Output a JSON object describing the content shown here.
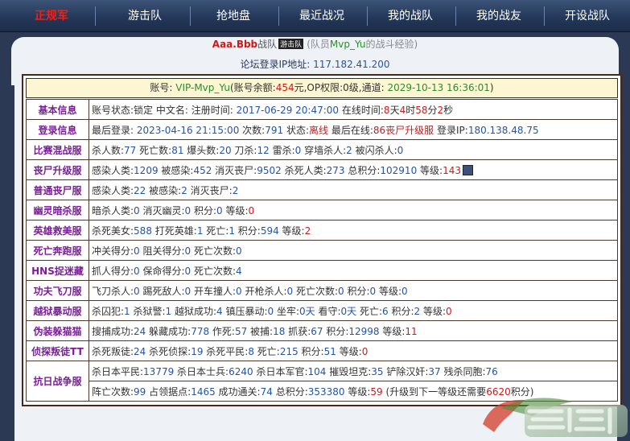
{
  "nav": [
    "正规军",
    "游击队",
    "抢地盘",
    "最近战况",
    "我的战队",
    "我的战友",
    "开设战队"
  ],
  "title": {
    "name": "Aaa.Bbb",
    "suffix": "战队",
    "tag": "游击队",
    "note_pre": "(队员",
    "player": "Mvp_Yu",
    "note_post": "的战斗经验)"
  },
  "ip": {
    "label": "论坛登录IP地址:",
    "value": "117.182.41.200"
  },
  "account": {
    "label": "账号:",
    "id": "VIP-Mvp_Yu",
    "bal_pre": "(账号余额:",
    "balance": "454",
    "bal_post": "元,OP权限:0级,通道:",
    "channel": "2029-10-13 16:36:01",
    "close": ")"
  },
  "basic": {
    "label": "基本信息",
    "t1": "账号状态:锁定 中文名: 注册时间:",
    "reg": "2017-06-29 20:47:00",
    "t2": "在线时间:",
    "d": "8",
    "t3": "天",
    "h": "4",
    "t4": "时",
    "m": "58",
    "t5": "分",
    "s": "2",
    "t6": "秒"
  },
  "login": {
    "label": "登录信息",
    "t1": "最后登录:",
    "last": "2023-04-16 21:15:00",
    "t2": "次数:",
    "count": "791",
    "t3": "状态:",
    "state": "离线",
    "t4": "最后在线:",
    "server": "86丧尸升级服",
    "t5": "登录IP:",
    "ip": "180.138.48.75"
  },
  "modes": [
    {
      "label": "比赛混战服",
      "parts": [
        [
          "杀人数:",
          ""
        ],
        [
          "77",
          "b"
        ],
        [
          " 死亡数:",
          ""
        ],
        [
          "81",
          "b"
        ],
        [
          " 爆头数:",
          ""
        ],
        [
          "20",
          "b"
        ],
        [
          " 刀杀:",
          ""
        ],
        [
          "12",
          "b"
        ],
        [
          " 雷杀:",
          ""
        ],
        [
          "0",
          "b"
        ],
        [
          " 穿墙杀人:",
          ""
        ],
        [
          "2",
          "b"
        ],
        [
          " 被闪杀人:",
          ""
        ],
        [
          "0",
          "b"
        ]
      ]
    },
    {
      "label": "丧尸升级服",
      "parts": [
        [
          "感染人类:",
          ""
        ],
        [
          "1209",
          "b"
        ],
        [
          " 被感染:",
          ""
        ],
        [
          "452",
          "b"
        ],
        [
          " 消灭丧尸:",
          ""
        ],
        [
          "9502",
          "b"
        ],
        [
          " 杀死人类:",
          ""
        ],
        [
          "273",
          "b"
        ],
        [
          " 总积分:",
          ""
        ],
        [
          "102910",
          "b"
        ],
        [
          " 等级:",
          ""
        ],
        [
          "143",
          "r"
        ]
      ],
      "badge": true
    },
    {
      "label": "普通丧尸服",
      "parts": [
        [
          "感染人类:",
          ""
        ],
        [
          "22",
          "b"
        ],
        [
          " 被感染:",
          ""
        ],
        [
          "2",
          "b"
        ],
        [
          " 消灭丧尸:",
          ""
        ],
        [
          "2",
          "b"
        ]
      ]
    },
    {
      "label": "幽灵暗杀服",
      "parts": [
        [
          "暗杀人类:",
          ""
        ],
        [
          "0",
          "b"
        ],
        [
          " 消灭幽灵:",
          ""
        ],
        [
          "0",
          "b"
        ],
        [
          " 积分:",
          ""
        ],
        [
          "0",
          "b"
        ],
        [
          " 等级:",
          ""
        ],
        [
          "0",
          "r"
        ]
      ]
    },
    {
      "label": "英雄救美服",
      "parts": [
        [
          "杀死美女:",
          ""
        ],
        [
          "588",
          "b"
        ],
        [
          " 打死英雄:",
          ""
        ],
        [
          "1",
          "b"
        ],
        [
          " 死亡:",
          ""
        ],
        [
          "1",
          "b"
        ],
        [
          " 积分:",
          ""
        ],
        [
          "594",
          "b"
        ],
        [
          " 等级:",
          ""
        ],
        [
          "2",
          "r"
        ]
      ]
    },
    {
      "label": "死亡奔跑服",
      "parts": [
        [
          "冲关得分:",
          ""
        ],
        [
          "0",
          "b"
        ],
        [
          " 阻关得分:",
          ""
        ],
        [
          "0",
          "b"
        ],
        [
          " 死亡次数:",
          ""
        ],
        [
          "0",
          "b"
        ]
      ]
    },
    {
      "label": "HNS捉迷藏",
      "parts": [
        [
          "抓人得分:",
          ""
        ],
        [
          "0",
          "b"
        ],
        [
          " 保命得分:",
          ""
        ],
        [
          "0",
          "b"
        ],
        [
          " 死亡次数:",
          ""
        ],
        [
          "4",
          "b"
        ]
      ]
    },
    {
      "label": "功夫飞刀服",
      "parts": [
        [
          "飞刀杀人:",
          ""
        ],
        [
          "0",
          "b"
        ],
        [
          " 踢死敌人:",
          ""
        ],
        [
          "0",
          "b"
        ],
        [
          " 开车撞人:",
          ""
        ],
        [
          "0",
          "b"
        ],
        [
          " 开枪杀人:",
          ""
        ],
        [
          "0",
          "b"
        ],
        [
          " 死亡次数:",
          ""
        ],
        [
          "0",
          "b"
        ],
        [
          " 积分:",
          ""
        ],
        [
          "0",
          "b"
        ],
        [
          " 等级:",
          ""
        ],
        [
          "0",
          "b"
        ]
      ]
    },
    {
      "label": "越狱暴动服",
      "parts": [
        [
          "杀囚犯:",
          ""
        ],
        [
          "1",
          "b"
        ],
        [
          " 杀狱警:",
          ""
        ],
        [
          "1",
          "b"
        ],
        [
          " 越狱成功:",
          ""
        ],
        [
          "4",
          "b"
        ],
        [
          " 镇压暴动:",
          ""
        ],
        [
          "0",
          "b"
        ],
        [
          " 坐牢:",
          ""
        ],
        [
          "0天",
          "b"
        ],
        [
          " 看守:",
          ""
        ],
        [
          "0天",
          "b"
        ],
        [
          " 死亡:",
          ""
        ],
        [
          "6",
          "b"
        ],
        [
          " 积分:",
          ""
        ],
        [
          "2",
          "b"
        ],
        [
          " 等级:",
          ""
        ],
        [
          "0",
          "r"
        ]
      ]
    },
    {
      "label": "伪装躲猫猫",
      "parts": [
        [
          "搜捕成功:",
          ""
        ],
        [
          "24",
          "b"
        ],
        [
          " 躲藏成功:",
          ""
        ],
        [
          "778",
          "b"
        ],
        [
          " 作死:",
          ""
        ],
        [
          "57",
          "b"
        ],
        [
          " 被捕:",
          ""
        ],
        [
          "18",
          "b"
        ],
        [
          " 抓获:",
          ""
        ],
        [
          "67",
          "b"
        ],
        [
          " 积分:",
          ""
        ],
        [
          "12998",
          "b"
        ],
        [
          " 等级:",
          ""
        ],
        [
          "11",
          "r"
        ]
      ]
    },
    {
      "label": "侦探叛徒TT",
      "parts": [
        [
          "杀死叛徒:",
          ""
        ],
        [
          "24",
          "b"
        ],
        [
          " 杀死侦探:",
          ""
        ],
        [
          "19",
          "b"
        ],
        [
          " 杀死平民:",
          ""
        ],
        [
          "8",
          "b"
        ],
        [
          " 死亡:",
          ""
        ],
        [
          "215",
          "b"
        ],
        [
          " 积分:",
          ""
        ],
        [
          "51",
          "b"
        ],
        [
          " 等级:",
          ""
        ],
        [
          "0",
          "r"
        ]
      ]
    }
  ],
  "war": {
    "label": "抗日战争服",
    "line1": [
      [
        "杀日本平民:",
        ""
      ],
      [
        "13779",
        "b"
      ],
      [
        " 杀日本士兵:",
        ""
      ],
      [
        "6240",
        "b"
      ],
      [
        " 杀日本军官:",
        ""
      ],
      [
        "104",
        "b"
      ],
      [
        " 摧毁坦克:",
        ""
      ],
      [
        "35",
        "b"
      ],
      [
        " 铲除汉奸:",
        ""
      ],
      [
        "37",
        "b"
      ],
      [
        " 残杀同胞:",
        ""
      ],
      [
        "76",
        "b"
      ]
    ],
    "line2": [
      [
        "阵亡次数:",
        ""
      ],
      [
        "99",
        "b"
      ],
      [
        " 占领据点:",
        ""
      ],
      [
        "1465",
        "b"
      ],
      [
        " 成功通关:",
        ""
      ],
      [
        "74",
        "b"
      ],
      [
        " 总积分:",
        ""
      ],
      [
        "353380",
        "b"
      ],
      [
        " 等级:",
        ""
      ],
      [
        "59",
        "r"
      ],
      [
        " (升级到下一等级还需要",
        ""
      ],
      [
        "6620",
        "r"
      ],
      [
        "积分)",
        ""
      ]
    ]
  }
}
